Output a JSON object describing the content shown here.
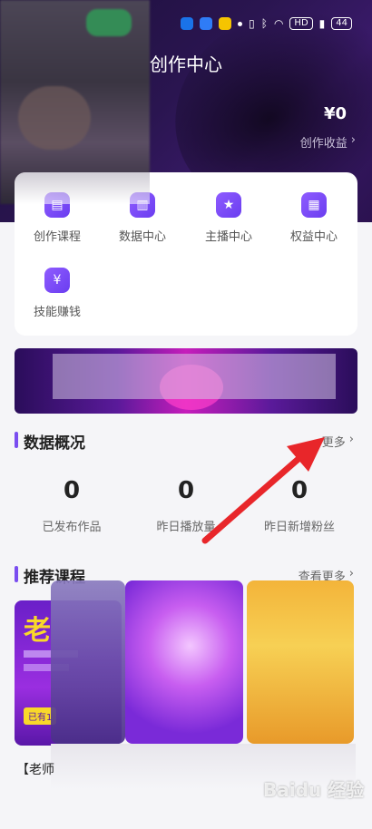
{
  "status": {
    "battery": "44",
    "hd_label": "HD"
  },
  "header": {
    "title": "创作中心",
    "income_amount": "¥0",
    "income_label": "创作收益"
  },
  "menu": {
    "items": [
      {
        "label": "创作课程",
        "icon": "book-icon"
      },
      {
        "label": "数据中心",
        "icon": "chart-icon"
      },
      {
        "label": "主播中心",
        "icon": "star-user-icon"
      },
      {
        "label": "权益中心",
        "icon": "grid-icon"
      },
      {
        "label": "技能赚钱",
        "icon": "money-bag-icon"
      }
    ]
  },
  "overview": {
    "title": "数据概况",
    "more": "更多",
    "stats": [
      {
        "value": "0",
        "label": "已发布作品"
      },
      {
        "value": "0",
        "label": "昨日播放量"
      },
      {
        "value": "0",
        "label": "昨日新增粉丝"
      }
    ]
  },
  "courses": {
    "title": "推荐课程",
    "more": "查看更多",
    "first_card": {
      "big_text": "老",
      "chip": "已有1",
      "title": "【老师"
    }
  },
  "watermark": "Baidu 经验",
  "colors": {
    "accent": "#7a4df0",
    "arrow": "#e8262a"
  }
}
